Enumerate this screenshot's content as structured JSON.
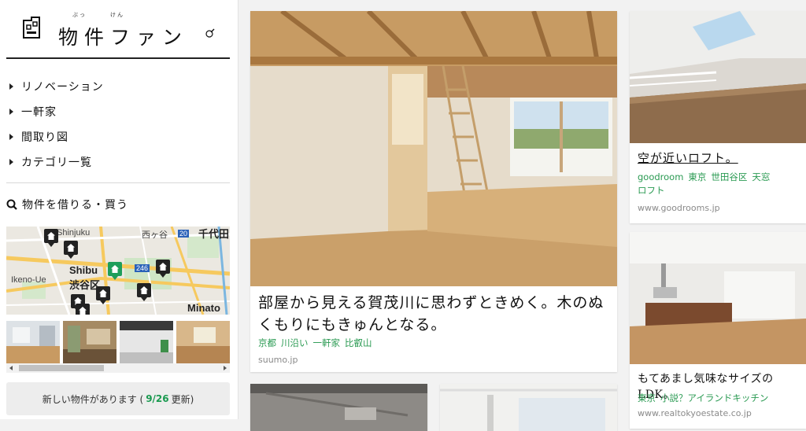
{
  "logo": {
    "text": "物件ファン",
    "ruby1": "ぶっ",
    "ruby2": "けん"
  },
  "nav": {
    "items": [
      {
        "label": "リノベーション"
      },
      {
        "label": "一軒家"
      },
      {
        "label": "間取り図"
      },
      {
        "label": "カテゴリ一覧"
      }
    ]
  },
  "search": {
    "heading": "物件を借りる・買う"
  },
  "map": {
    "labels": [
      "Shinjuku",
      "Shibu",
      "渋谷区",
      "Ikeno-Ue",
      "Minato",
      "千代田",
      "西ヶ谷",
      "246",
      "20"
    ]
  },
  "notice": {
    "prefix": "新しい物件があります (",
    "count": "9/26",
    "suffix": " 更新)"
  },
  "cards": [
    {
      "title": "部屋から見える賀茂川に思わずときめく。木のぬくもりにもきゅんとなる。",
      "tags": [
        "京都",
        "川沿い",
        "一軒家",
        "比叡山"
      ],
      "source": "suumo.jp"
    },
    {
      "title": "空が近いロフト。",
      "tags": [
        "goodroom",
        "東京",
        "世田谷区",
        "天窓",
        "ロフト"
      ],
      "source": "www.goodrooms.jp"
    },
    {
      "title": "もてあまし気味なサイズのLDK。",
      "tags": [
        "東京",
        "小説？アイランドキッチン"
      ],
      "source": "www.realtokyoestate.co.jp"
    }
  ]
}
